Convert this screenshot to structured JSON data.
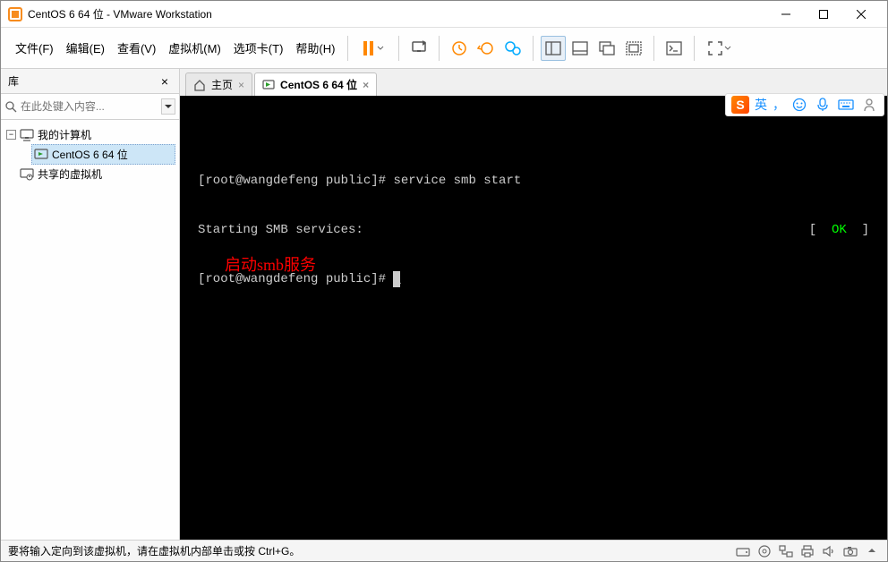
{
  "titlebar": {
    "title": "CentOS 6 64 位 - VMware Workstation"
  },
  "menu": {
    "file": "文件(F)",
    "edit": "编辑(E)",
    "view": "查看(V)",
    "vm": "虚拟机(M)",
    "tabs": "选项卡(T)",
    "help": "帮助(H)"
  },
  "sidebar": {
    "title": "库",
    "search_placeholder": "在此处键入内容...",
    "node_root": "我的计算机",
    "node_centos": "CentOS 6 64 位",
    "node_shared": "共享的虚拟机"
  },
  "tabs": {
    "home": "主页",
    "centos": "CentOS 6 64 位"
  },
  "terminal": {
    "line1_prompt": "[root@wangdefeng public]# ",
    "line1_cmd": "service smb start",
    "line2_left": "Starting SMB services:",
    "line2_lb": "[  ",
    "line2_ok": "OK",
    "line2_rb": "  ]",
    "line3_prompt": "[root@wangdefeng public]# ",
    "annotation": "启动smb服务"
  },
  "statusbar": {
    "msg": "要将输入定向到该虚拟机，请在虚拟机内部单击或按 Ctrl+G。"
  },
  "ime": {
    "lang": "英",
    "comma": "，"
  }
}
